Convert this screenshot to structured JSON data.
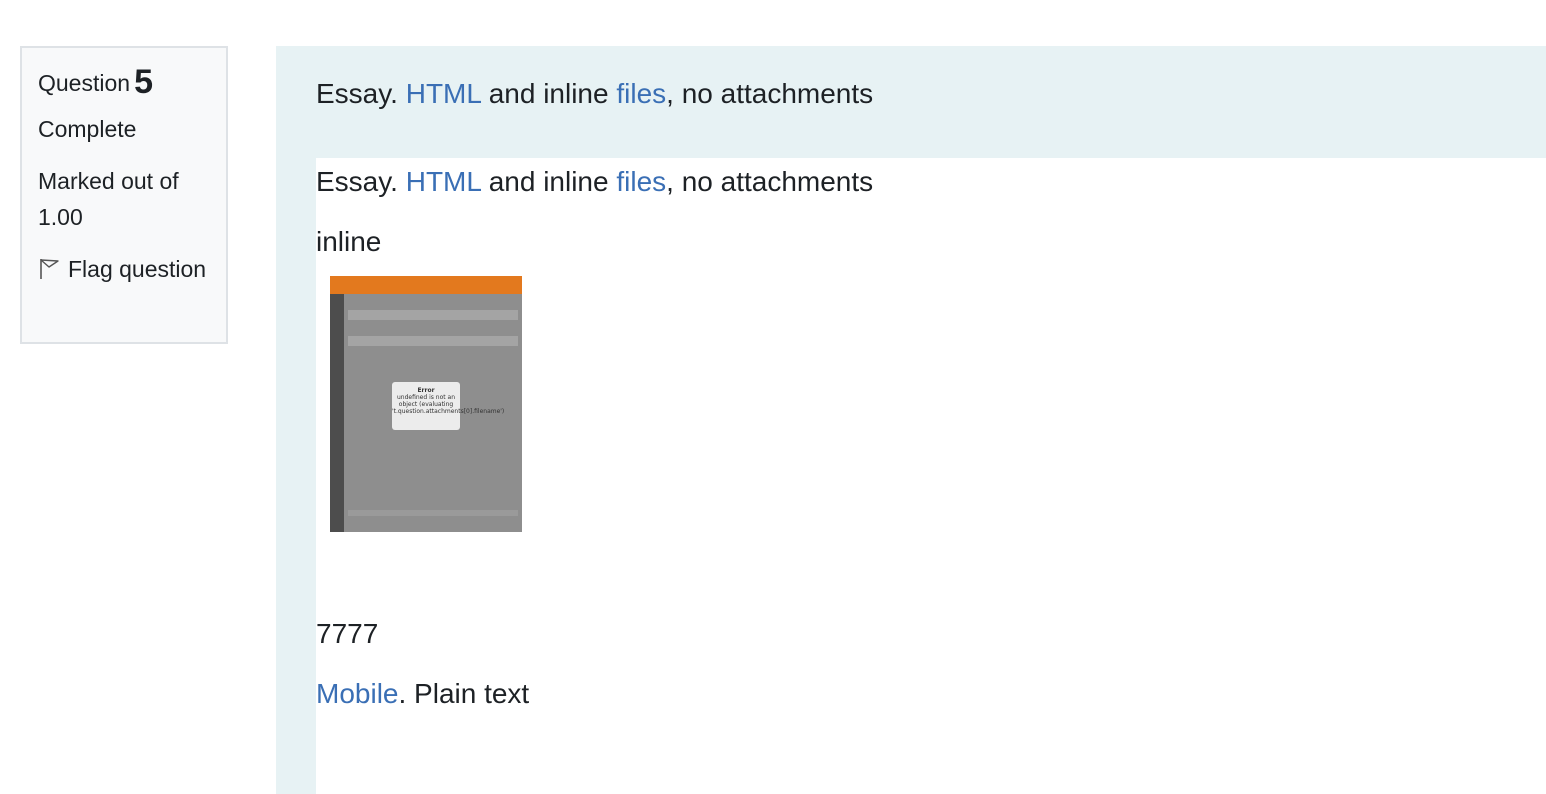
{
  "info": {
    "question_label": "Question",
    "question_number": "5",
    "state": "Complete",
    "grade": "Marked out of 1.00",
    "flag_label": "Flag question",
    "flag_icon": "flag-outline-icon"
  },
  "question_text": {
    "prefix": "Essay. ",
    "link1": "HTML",
    "middle": " and inline ",
    "link2": "files",
    "suffix": ", no attachments"
  },
  "response": {
    "heading": {
      "prefix": "Essay. ",
      "link1": "HTML",
      "middle": " and inline ",
      "link2": "files",
      "suffix": ", no attachments"
    },
    "word": "inline",
    "embedded_image": {
      "dialog_title": "Error",
      "dialog_text": "undefined is not an object (evaluating 't.question.attachments[0].filename')"
    },
    "number": "7777",
    "mobile_link": "Mobile",
    "mobile_suffix": ". Plain text"
  }
}
